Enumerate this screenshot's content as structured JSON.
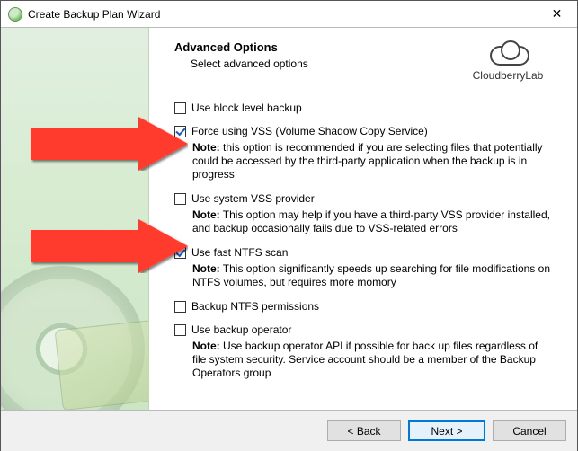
{
  "window": {
    "title": "Create Backup Plan Wizard"
  },
  "brand": {
    "name": "CloudberryLab"
  },
  "header": {
    "title": "Advanced Options",
    "subtitle": "Select advanced options"
  },
  "options": {
    "block_level": {
      "label": "Use block level backup",
      "checked": false
    },
    "force_vss": {
      "label": "Force using VSS (Volume Shadow Copy Service)",
      "checked": true,
      "note_label": "Note:",
      "note": "this option is recommended if you are selecting files that potentially could be accessed by the third-party application when the backup is in progress"
    },
    "system_vss": {
      "label": "Use system VSS provider",
      "checked": false,
      "note_label": "Note:",
      "note": "This option may help if you have a third-party VSS provider installed, and backup occasionally fails due to VSS-related errors"
    },
    "fast_ntfs": {
      "label": "Use fast NTFS scan",
      "checked": true,
      "note_label": "Note:",
      "note": "This option significantly speeds up searching for file modifications on NTFS volumes, but requires more momory"
    },
    "backup_perms": {
      "label": "Backup NTFS permissions",
      "checked": false
    },
    "backup_operator": {
      "label": "Use backup operator",
      "checked": false,
      "note_label": "Note:",
      "note": "Use backup operator API if possible for back up files regardless of file system security. Service account should be a member of the Backup Operators group"
    }
  },
  "buttons": {
    "back": "< Back",
    "next": "Next >",
    "cancel": "Cancel"
  }
}
